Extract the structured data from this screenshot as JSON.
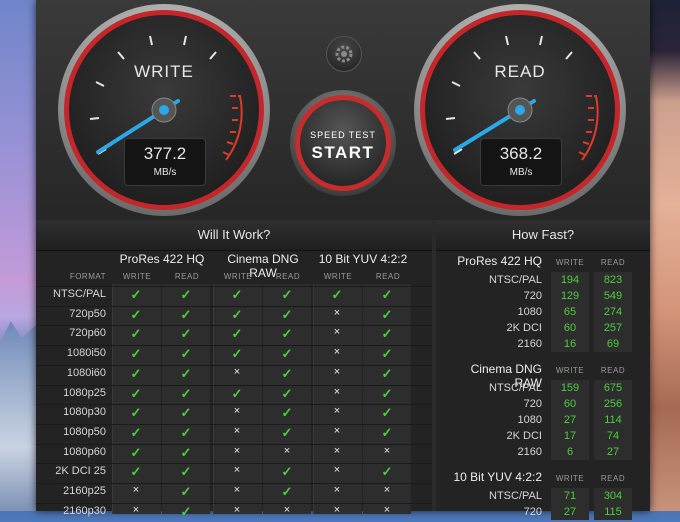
{
  "gauges": {
    "write": {
      "title": "WRITE",
      "value": "377.2",
      "unit": "MB/s"
    },
    "read": {
      "title": "READ",
      "value": "368.2",
      "unit": "MB/s"
    }
  },
  "start_button": {
    "line1": "SPEED TEST",
    "line2": "START"
  },
  "will_it_work": {
    "title": "Will It Work?",
    "format_label": "FORMAT",
    "groups": [
      "ProRes 422 HQ",
      "Cinema DNG RAW",
      "10 Bit YUV 4:2:2"
    ],
    "sub_labels": [
      "WRITE",
      "READ"
    ],
    "rows": [
      {
        "format": "NTSC/PAL",
        "marks": [
          "✓",
          "✓",
          "✓",
          "✓",
          "✓",
          "✓"
        ]
      },
      {
        "format": "720p50",
        "marks": [
          "✓",
          "✓",
          "✓",
          "✓",
          "×",
          "✓"
        ]
      },
      {
        "format": "720p60",
        "marks": [
          "✓",
          "✓",
          "✓",
          "✓",
          "×",
          "✓"
        ]
      },
      {
        "format": "1080i50",
        "marks": [
          "✓",
          "✓",
          "✓",
          "✓",
          "×",
          "✓"
        ]
      },
      {
        "format": "1080i60",
        "marks": [
          "✓",
          "✓",
          "×",
          "✓",
          "×",
          "✓"
        ]
      },
      {
        "format": "1080p25",
        "marks": [
          "✓",
          "✓",
          "✓",
          "✓",
          "×",
          "✓"
        ]
      },
      {
        "format": "1080p30",
        "marks": [
          "✓",
          "✓",
          "×",
          "✓",
          "×",
          "✓"
        ]
      },
      {
        "format": "1080p50",
        "marks": [
          "✓",
          "✓",
          "×",
          "✓",
          "×",
          "✓"
        ]
      },
      {
        "format": "1080p60",
        "marks": [
          "✓",
          "✓",
          "×",
          "×",
          "×",
          "×"
        ]
      },
      {
        "format": "2K DCI 25",
        "marks": [
          "✓",
          "✓",
          "×",
          "✓",
          "×",
          "✓"
        ]
      },
      {
        "format": "2160p25",
        "marks": [
          "×",
          "✓",
          "×",
          "✓",
          "×",
          "×"
        ]
      },
      {
        "format": "2160p30",
        "marks": [
          "×",
          "✓",
          "×",
          "×",
          "×",
          "×"
        ]
      }
    ]
  },
  "how_fast": {
    "title": "How Fast?",
    "sub_labels": [
      "WRITE",
      "READ"
    ],
    "sections": [
      {
        "name": "ProRes 422 HQ",
        "rows": [
          {
            "label": "NTSC/PAL",
            "write": "194",
            "read": "823"
          },
          {
            "label": "720",
            "write": "129",
            "read": "549"
          },
          {
            "label": "1080",
            "write": "65",
            "read": "274"
          },
          {
            "label": "2K DCI",
            "write": "60",
            "read": "257"
          },
          {
            "label": "2160",
            "write": "16",
            "read": "69"
          }
        ]
      },
      {
        "name": "Cinema DNG RAW",
        "rows": [
          {
            "label": "NTSC/PAL",
            "write": "159",
            "read": "675"
          },
          {
            "label": "720",
            "write": "60",
            "read": "256"
          },
          {
            "label": "1080",
            "write": "27",
            "read": "114"
          },
          {
            "label": "2K DCI",
            "write": "17",
            "read": "74"
          },
          {
            "label": "2160",
            "write": "6",
            "read": "27"
          }
        ]
      },
      {
        "name": "10 Bit YUV 4:2:2",
        "rows": [
          {
            "label": "NTSC/PAL",
            "write": "71",
            "read": "304"
          },
          {
            "label": "720",
            "write": "27",
            "read": "115"
          }
        ]
      }
    ]
  },
  "colors": {
    "accent_red": "#c4262a",
    "needle_blue": "#2aa8e8",
    "ok_green": "#4ccf3d"
  },
  "icons": {
    "settings": "gear-icon",
    "ok": "check-icon",
    "fail": "cross-icon"
  }
}
